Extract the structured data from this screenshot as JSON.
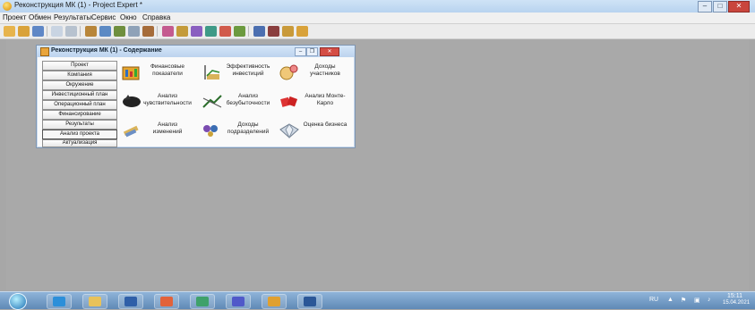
{
  "window": {
    "title": "Реконструкция МК (1) - Project Expert *"
  },
  "menubar": {
    "items": [
      "Проект",
      "Обмен",
      "Результаты",
      "Сервис",
      "Окно",
      "Справка"
    ]
  },
  "toolbar": {
    "icons": [
      "open-project-icon",
      "folder-icon",
      "save-icon",
      "print-preview-icon",
      "print-icon",
      "company-icon",
      "environment-icon",
      "investment-plan-icon",
      "operations-plan-icon",
      "financing-icon",
      "results-icon",
      "analysis-icon",
      "reports-icon",
      "table-icon",
      "chart-icon",
      "update-icon",
      "subdivisions-icon",
      "portfolio-icon",
      "folder-open-icon",
      "bar-chart-icon"
    ]
  },
  "child_window": {
    "title": "Реконструкция МК (1) - Содержание",
    "nav": [
      "Проект",
      "Компания",
      "Окружение",
      "Инвестиционный план",
      "Операционный план",
      "Финансирование",
      "Результаты",
      "Анализ проекта",
      "Актуализация"
    ],
    "active_nav_index": 7,
    "grid": [
      {
        "label": "Финансовые показатели",
        "icon": "financial-indicators-icon"
      },
      {
        "label": "Эффективность инвестиций",
        "icon": "investment-efficiency-icon"
      },
      {
        "label": "Доходы участников",
        "icon": "participants-income-icon"
      },
      {
        "label": "Анализ чувствительности",
        "icon": "sensitivity-analysis-icon"
      },
      {
        "label": "Анализ безубыточности",
        "icon": "break-even-icon"
      },
      {
        "label": "Анализ Монте-Карло",
        "icon": "monte-carlo-icon"
      },
      {
        "label": "Анализ изменений",
        "icon": "change-analysis-icon"
      },
      {
        "label": "Доходы подразделений",
        "icon": "subdivision-income-icon"
      },
      {
        "label": "Оценка бизнеса",
        "icon": "business-valuation-icon"
      }
    ]
  },
  "taskbar": {
    "language": "RU",
    "time": "15:11",
    "date": "15.04.2021"
  },
  "colors": {
    "workspace": "#a9a9a9",
    "titlebar": "#c7dcf2",
    "close_button": "#c9463d"
  }
}
